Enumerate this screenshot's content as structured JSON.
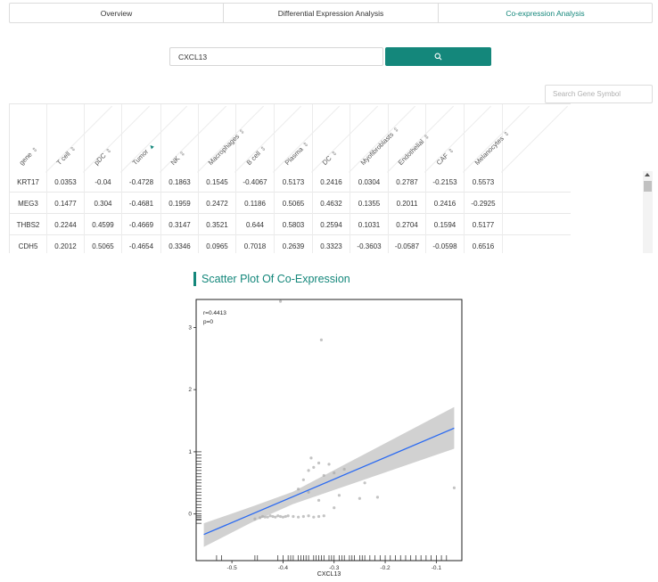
{
  "tabs": [
    {
      "label": "Overview",
      "active": false
    },
    {
      "label": "Differential Expression Analysis",
      "active": false
    },
    {
      "label": "Co-expression Analysis",
      "active": true
    }
  ],
  "search": {
    "value": "CXCL13",
    "button_icon": "search-icon"
  },
  "gene_search": {
    "placeholder": "Search Gene Symbol"
  },
  "table": {
    "columns": [
      "gene",
      "T cell",
      "pDC",
      "Tumor",
      "NK",
      "Macrophages",
      "B cell",
      "Plasma",
      "DC",
      "Myofibroblasts",
      "Endothelial",
      "CAF",
      "Melanocytes"
    ],
    "sorted_column": "Tumor",
    "rows": [
      [
        "KRT17",
        "0.0353",
        "-0.04",
        "-0.4728",
        "0.1863",
        "0.1545",
        "-0.4067",
        "0.5173",
        "0.2416",
        "0.0304",
        "0.2787",
        "-0.2153",
        "0.5573"
      ],
      [
        "MEG3",
        "0.1477",
        "0.304",
        "-0.4681",
        "0.1959",
        "0.2472",
        "0.1186",
        "0.5065",
        "0.4632",
        "0.1355",
        "0.2011",
        "0.2416",
        "-0.2925"
      ],
      [
        "THBS2",
        "0.2244",
        "0.4599",
        "-0.4669",
        "0.3147",
        "0.3521",
        "0.644",
        "0.5803",
        "0.2594",
        "0.1031",
        "0.2704",
        "0.1594",
        "0.5177"
      ],
      [
        "CDH5",
        "0.2012",
        "0.5065",
        "-0.4654",
        "0.3346",
        "0.0965",
        "0.7018",
        "0.2639",
        "0.3323",
        "-0.3603",
        "-0.0587",
        "-0.0598",
        "0.6516"
      ]
    ]
  },
  "scatter": {
    "title": "Scatter Plot Of Co-Expression",
    "annotation_r": "r=0.4413",
    "annotation_p": "p=0"
  },
  "chart_data": {
    "type": "scatter",
    "xlabel": "CXCL13",
    "ylabel": "",
    "xlim": [
      -0.57,
      -0.05
    ],
    "ylim": [
      -0.75,
      3.45
    ],
    "xticks": [
      "-0.5",
      "-0.4",
      "-0.3",
      "-0.2",
      "-0.1"
    ],
    "yticks": [
      "0",
      "1",
      "2",
      "3"
    ],
    "points": [
      {
        "x": -0.43,
        "y": -0.05
      },
      {
        "x": -0.425,
        "y": -0.03
      },
      {
        "x": -0.42,
        "y": -0.04
      },
      {
        "x": -0.415,
        "y": -0.05
      },
      {
        "x": -0.41,
        "y": -0.03
      },
      {
        "x": -0.405,
        "y": -0.04
      },
      {
        "x": -0.4,
        "y": -0.05
      },
      {
        "x": -0.395,
        "y": -0.04
      },
      {
        "x": -0.39,
        "y": -0.03
      },
      {
        "x": -0.445,
        "y": -0.06
      },
      {
        "x": -0.44,
        "y": -0.04
      },
      {
        "x": -0.435,
        "y": -0.05
      },
      {
        "x": -0.455,
        "y": -0.08
      },
      {
        "x": -0.38,
        "y": -0.04
      },
      {
        "x": -0.37,
        "y": -0.05
      },
      {
        "x": -0.36,
        "y": -0.04
      },
      {
        "x": -0.35,
        "y": -0.03
      },
      {
        "x": -0.34,
        "y": -0.05
      },
      {
        "x": -0.33,
        "y": -0.04
      },
      {
        "x": -0.32,
        "y": -0.03
      },
      {
        "x": -0.34,
        "y": 0.75
      },
      {
        "x": -0.33,
        "y": 0.82
      },
      {
        "x": -0.35,
        "y": 0.7
      },
      {
        "x": -0.32,
        "y": 0.62
      },
      {
        "x": -0.36,
        "y": 0.55
      },
      {
        "x": -0.3,
        "y": 0.66
      },
      {
        "x": -0.31,
        "y": 0.8
      },
      {
        "x": -0.345,
        "y": 0.9
      },
      {
        "x": -0.28,
        "y": 0.72
      },
      {
        "x": -0.29,
        "y": 0.3
      },
      {
        "x": -0.37,
        "y": 0.4
      },
      {
        "x": -0.33,
        "y": 0.22
      },
      {
        "x": -0.3,
        "y": 0.1
      },
      {
        "x": -0.25,
        "y": 0.25
      },
      {
        "x": -0.35,
        "y": 0.35
      },
      {
        "x": -0.24,
        "y": 0.5
      },
      {
        "x": -0.215,
        "y": 0.27
      },
      {
        "x": -0.405,
        "y": 3.42
      },
      {
        "x": -0.325,
        "y": 2.8
      },
      {
        "x": -0.065,
        "y": 0.42
      }
    ],
    "regression": {
      "x": [
        -0.555,
        -0.065
      ],
      "y": [
        -0.33,
        1.38
      ]
    },
    "confidence_band": {
      "x": [
        -0.555,
        -0.46,
        -0.38,
        -0.065
      ],
      "upper": [
        -0.15,
        0.12,
        0.36,
        1.72
      ],
      "lower": [
        -0.53,
        -0.13,
        0.16,
        1.05
      ]
    }
  }
}
